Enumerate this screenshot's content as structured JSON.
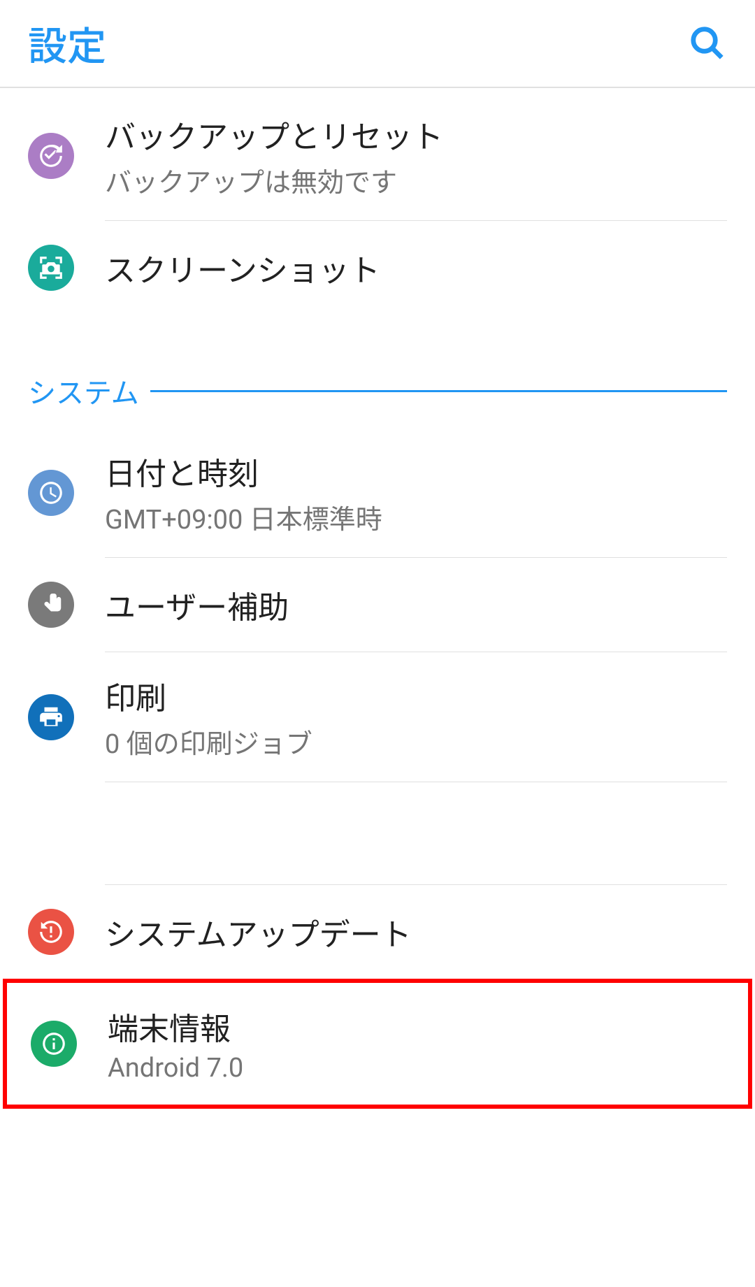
{
  "header": {
    "title": "設定"
  },
  "items": {
    "backup": {
      "title": "バックアップとリセット",
      "subtitle": "バックアップは無効です"
    },
    "screenshot": {
      "title": "スクリーンショット"
    }
  },
  "section": {
    "system": "システム"
  },
  "system_items": {
    "datetime": {
      "title": "日付と時刻",
      "subtitle": "GMT+09:00 日本標準時"
    },
    "accessibility": {
      "title": "ユーザー補助"
    },
    "print": {
      "title": "印刷",
      "subtitle": "0 個の印刷ジョブ"
    },
    "update": {
      "title": "システムアップデート"
    },
    "about": {
      "title": "端末情報",
      "subtitle": "Android 7.0"
    }
  }
}
